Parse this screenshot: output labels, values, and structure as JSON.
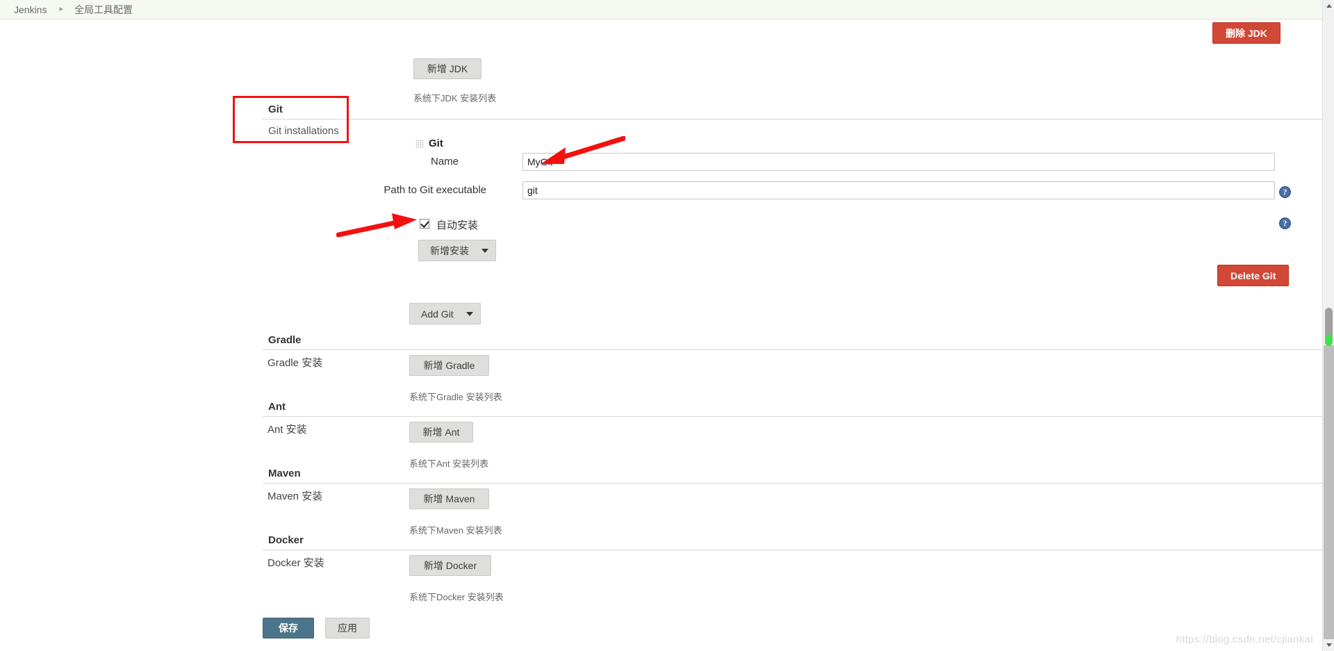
{
  "breadcrumb": {
    "items": [
      {
        "label": "Jenkins"
      },
      {
        "label": "全局工具配置"
      }
    ],
    "separator": "▸"
  },
  "jdk": {
    "add_button": "新增 JDK",
    "hint": "系统下JDK 安装列表",
    "delete_button": "删除 JDK"
  },
  "git": {
    "panel_title": "Git",
    "panel_subtitle": "Git installations",
    "entry_title": "Git",
    "name_label": "Name",
    "name_value": "MyGit",
    "path_label": "Path to Git executable",
    "path_value": "git",
    "auto_install_label": "自动安装",
    "auto_install_checked": true,
    "add_installer_button": "新增安装",
    "delete_button": "Delete Git",
    "add_git_button": "Add Git",
    "help_icon": "?"
  },
  "sections": [
    {
      "title": "Gradle",
      "row_label": "Gradle 安装",
      "add_button": "新增 Gradle",
      "hint": "系统下Gradle 安装列表"
    },
    {
      "title": "Ant",
      "row_label": "Ant 安装",
      "add_button": "新增 Ant",
      "hint": "系统下Ant 安装列表"
    },
    {
      "title": "Maven",
      "row_label": "Maven 安装",
      "add_button": "新增 Maven",
      "hint": "系统下Maven 安装列表"
    },
    {
      "title": "Docker",
      "row_label": "Docker 安装",
      "add_button": "新增 Docker",
      "hint": "系统下Docker 安装列表"
    }
  ],
  "footer": {
    "save_button": "保存",
    "apply_button": "应用"
  },
  "watermark": "https://blog.csdn.net/cjiankai",
  "colors": {
    "danger": "#d14836",
    "primary": "#4b758b",
    "annotation": "#f3100f",
    "breadcrumb_bg": "#f6f8f2",
    "scroll_indicator": "#44e04b"
  }
}
